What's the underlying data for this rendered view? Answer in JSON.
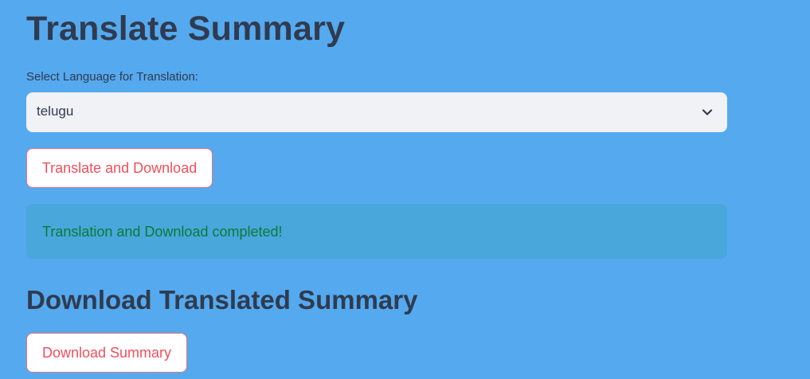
{
  "page": {
    "title": "Translate Summary",
    "background_color": "#55a9ee"
  },
  "language_select": {
    "label": "Select Language for Translation:",
    "selected_value": "telugu",
    "icon": "chevron-down-icon"
  },
  "translate_button": {
    "label": "Translate and Download",
    "color": "#ef4f5d"
  },
  "success_message": {
    "text": "Translation and Download completed!",
    "color": "#0c7a37"
  },
  "download_section": {
    "title": "Download Translated Summary",
    "button_label": "Download Summary"
  }
}
